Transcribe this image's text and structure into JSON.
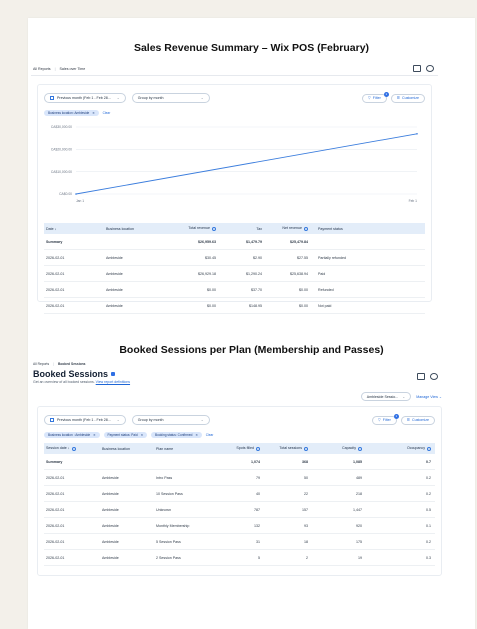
{
  "section1_title": "Sales Revenue Summary – Wix POS (February)",
  "section2_title": "Booked Sessions per Plan (Membership and Passes)",
  "report1": {
    "breadcrumb_root": "All Reports",
    "breadcrumb_current": "Sales over Time",
    "date_filter": "Previous month (Feb 1 - Feb 28...",
    "group_by": "Group by month",
    "filter_label": "Filter",
    "filter_count": "1",
    "customize_label": "Customize",
    "chips": [
      "Business location: Ambleside"
    ],
    "clear_label": "Clear",
    "chart_data": {
      "type": "line",
      "x": [
        "Jan 1",
        "Feb 1"
      ],
      "series": [
        {
          "values": [
            0,
            26959.63
          ]
        }
      ],
      "yticks": [
        "CA$30,000.00",
        "CA$20,000.00",
        "CA$10,000.00",
        "CA$0.00"
      ],
      "ylim": [
        0,
        30000
      ],
      "color": "#3b7ddd"
    },
    "table": {
      "headers": [
        "Date",
        "Business location",
        "Total revenue",
        "Tax",
        "Net revenue",
        "Payment status"
      ],
      "summary": [
        "Summary",
        "",
        "$26,959.63",
        "$1,479.79",
        "$25,479.84",
        ""
      ],
      "rows": [
        [
          "2026-02-01",
          "Ambleside",
          "$30.45",
          "$2.90",
          "$27.55",
          "Partially refunded"
        ],
        [
          "2026-02-01",
          "Ambleside",
          "$26,929.18",
          "$1,290.24",
          "$25,638.94",
          "Paid"
        ],
        [
          "2026-02-01",
          "Ambleside",
          "$0.00",
          "$37.70",
          "$0.00",
          "Refunded"
        ],
        [
          "2026-02-01",
          "Ambleside",
          "$0.00",
          "$148.95",
          "$0.00",
          "Not paid"
        ]
      ]
    }
  },
  "report2": {
    "breadcrumb_root": "All Reports",
    "breadcrumb_current": "Booked Sessions",
    "title": "Booked Sessions",
    "subtitle": "Get an overview of all booked sessions.",
    "subtitle_link": "View report definitions",
    "view_select": "Ambleside Sessio...",
    "manage_view": "Manage View",
    "date_filter": "Previous month (Feb 1 - Feb 28...",
    "group_by": "Group by month",
    "filter_label": "Filter",
    "filter_count": "1",
    "customize_label": "Customize",
    "chips": [
      "Business location : Ambleside",
      "Payment status: Paid",
      "Booking status: Confirmed"
    ],
    "clear_label": "Clear",
    "table": {
      "headers": [
        "Session date",
        "Business location",
        "Plan name",
        "Spots filled",
        "Total sessions",
        "Capacity",
        "Occupancy"
      ],
      "summary": [
        "Summary",
        "",
        "",
        "1,074",
        "368",
        "1,085",
        "0.7"
      ],
      "rows": [
        [
          "2026-02-01",
          "Ambleside",
          "Intro Pass",
          "79",
          "50",
          "489",
          "0.2"
        ],
        [
          "2026-02-01",
          "Ambleside",
          "10 Session Pass",
          "40",
          "22",
          "218",
          "0.2"
        ],
        [
          "2026-02-01",
          "Ambleside",
          "Unknown",
          "787",
          "157",
          "1,447",
          "0.5"
        ],
        [
          "2026-02-01",
          "Ambleside",
          "Monthly Membership",
          "132",
          "93",
          "920",
          "0.1"
        ],
        [
          "2026-02-01",
          "Ambleside",
          "5 Session Pass",
          "31",
          "18",
          "175",
          "0.2"
        ],
        [
          "2026-02-01",
          "Ambleside",
          "2 Session Pass",
          "5",
          "2",
          "19",
          "0.3"
        ]
      ]
    }
  }
}
